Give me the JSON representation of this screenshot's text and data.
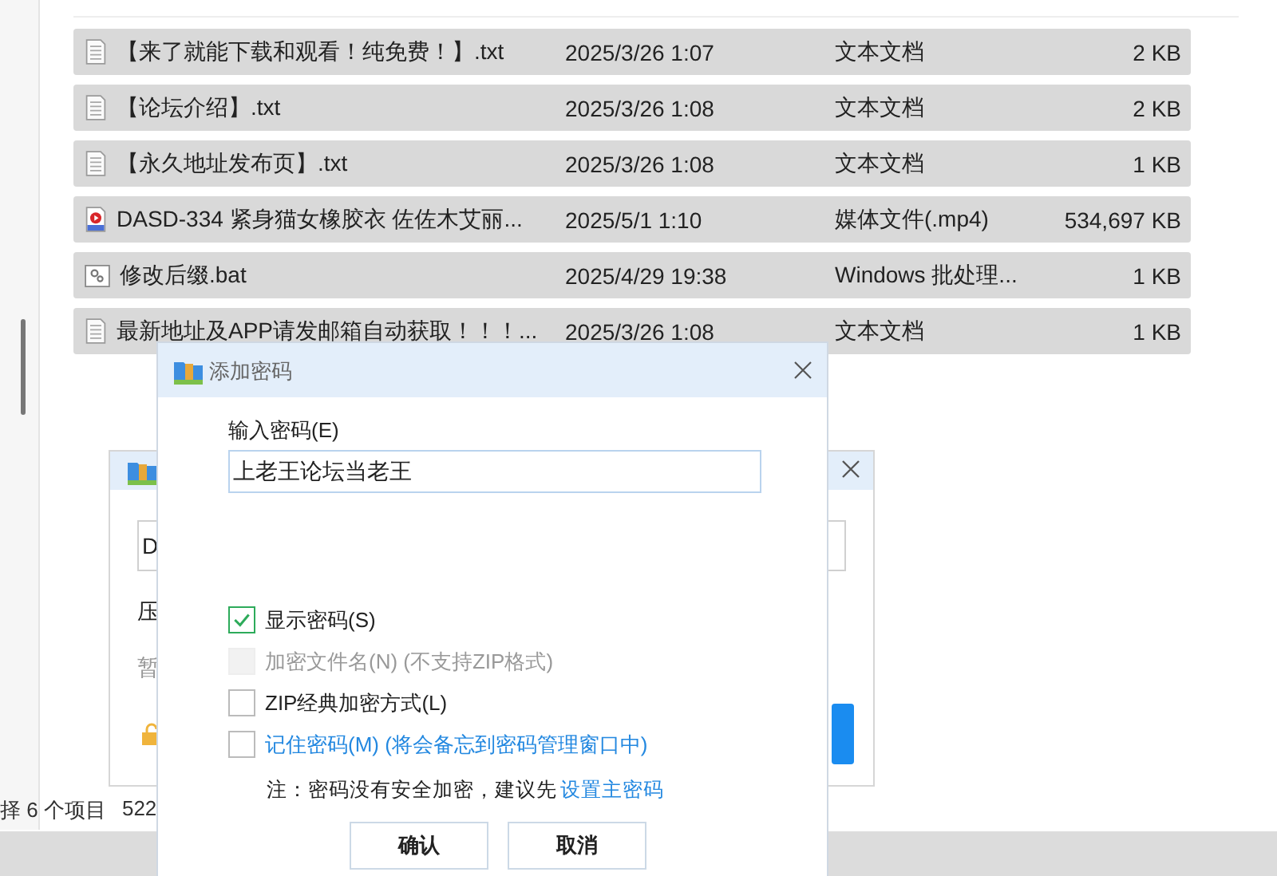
{
  "explorer": {
    "files": [
      {
        "name": "【来了就能下载和观看！纯免费！】.txt",
        "modified": "2025/3/26 1:07",
        "type": "文本文档",
        "size": "2 KB",
        "kind": "text",
        "selected": true
      },
      {
        "name": "【论坛介绍】.txt",
        "modified": "2025/3/26 1:08",
        "type": "文本文档",
        "size": "2 KB",
        "kind": "text",
        "selected": true
      },
      {
        "name": "【永久地址发布页】.txt",
        "modified": "2025/3/26 1:08",
        "type": "文本文档",
        "size": "1 KB",
        "kind": "text",
        "selected": true
      },
      {
        "name": "DASD-334 紧身猫女橡胶衣 佐佐木艾丽...",
        "modified": "2025/5/1 1:10",
        "type": "媒体文件(.mp4)",
        "size": "534,697 KB",
        "kind": "video",
        "selected": true
      },
      {
        "name": "修改后缀.bat",
        "modified": "2025/4/29 19:38",
        "type": "Windows 批处理...",
        "size": "1 KB",
        "kind": "script",
        "selected": true
      },
      {
        "name": "最新地址及APP请发邮箱自动获取！！！...",
        "modified": "2025/3/26 1:08",
        "type": "文本文档",
        "size": "1 KB",
        "kind": "text",
        "selected": true
      }
    ],
    "status": {
      "count": "择 6 个项目",
      "size": "522"
    }
  },
  "back_dialog": {
    "path_value": "D",
    "label_1": "压",
    "label_2": "暂"
  },
  "dialog": {
    "title": "添加密码",
    "password_label": "输入密码(E)",
    "password_value": "上老王论坛当老王",
    "options": [
      {
        "label": "显示密码(S)",
        "checked": true,
        "disabled": false,
        "kind": "plain"
      },
      {
        "label": "加密文件名(N) (不支持ZIP格式)",
        "checked": false,
        "disabled": true,
        "kind": "plain"
      },
      {
        "label": "ZIP经典加密方式(L)",
        "checked": false,
        "disabled": false,
        "kind": "plain"
      },
      {
        "label": "记住密码(M) (将会备忘到密码管理窗口中)",
        "checked": false,
        "disabled": false,
        "kind": "link"
      }
    ],
    "note": "注：密码没有安全加密，建议先",
    "note_link": "设置主密码",
    "buttons": [
      "确认",
      "取消"
    ]
  }
}
